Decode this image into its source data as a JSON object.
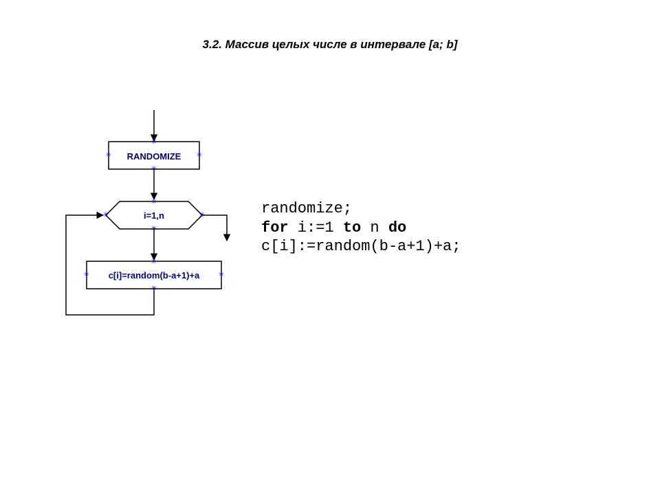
{
  "title": "3.2. Массив целых числе в интервале [a; b]",
  "flow": {
    "randomize": "RANDOMIZE",
    "loop": "i=1,n",
    "assign": "c[i]=random(b-a+1)+a"
  },
  "code": {
    "line1": "randomize;",
    "line2_for": "for",
    "line2_mid": " i:=1 ",
    "line2_to": "to",
    "line2_mid2": " n ",
    "line2_do": "do",
    "line3": "c[i]:=random(b-a+1)+a;"
  },
  "chart_data": {
    "type": "flowchart",
    "nodes": [
      {
        "id": "randomize",
        "shape": "process",
        "label": "RANDOMIZE"
      },
      {
        "id": "loop",
        "shape": "loop-hexagon",
        "label": "i=1,n"
      },
      {
        "id": "assign",
        "shape": "process",
        "label": "c[i]=random(b-a+1)+a"
      }
    ],
    "edges": [
      {
        "from": "start",
        "to": "randomize"
      },
      {
        "from": "randomize",
        "to": "loop"
      },
      {
        "from": "loop",
        "to": "assign",
        "kind": "body"
      },
      {
        "from": "assign",
        "to": "loop",
        "kind": "back"
      },
      {
        "from": "loop",
        "to": "end",
        "kind": "exit"
      }
    ],
    "code_listing": [
      "randomize;",
      "for i:=1 to n do",
      "c[i]:=random(b-a+1)+a;"
    ]
  }
}
